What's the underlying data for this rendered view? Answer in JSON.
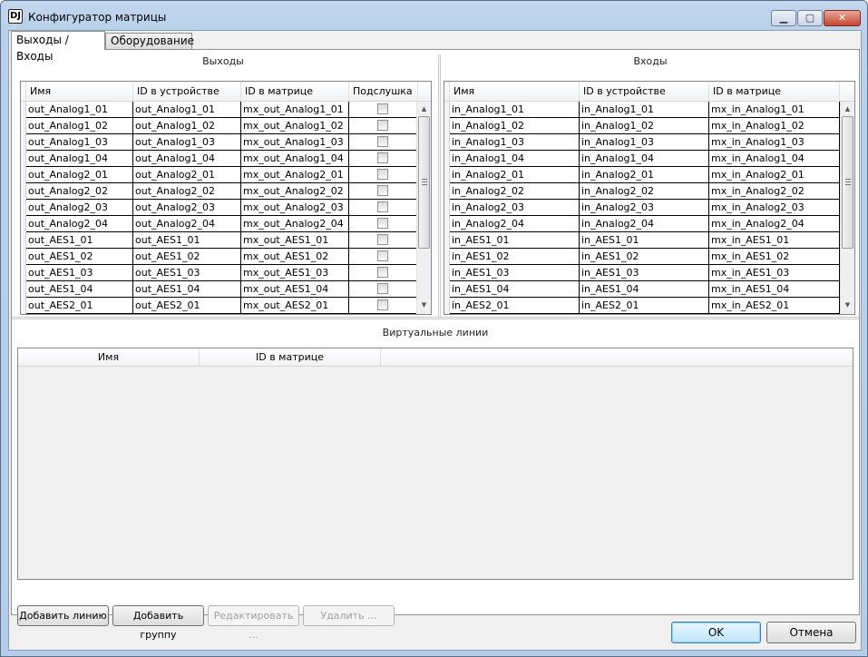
{
  "window": {
    "icon_text": "DJ",
    "title": "Конфигуратор матрицы",
    "min_glyph": "▁",
    "max_glyph": "▢",
    "close_glyph": "✕"
  },
  "tabs": [
    {
      "label": "Выходы / Входы",
      "active": true
    },
    {
      "label": "Оборудование",
      "active": false
    }
  ],
  "outputs": {
    "title": "Выходы",
    "columns": [
      "Имя",
      "ID в устройстве",
      "ID в матрице",
      "Подслушка"
    ],
    "rows": [
      [
        "out_Analog1_01",
        "out_Analog1_01",
        "mx_out_Analog1_01"
      ],
      [
        "out_Analog1_02",
        "out_Analog1_02",
        "mx_out_Analog1_02"
      ],
      [
        "out_Analog1_03",
        "out_Analog1_03",
        "mx_out_Analog1_03"
      ],
      [
        "out_Analog1_04",
        "out_Analog1_04",
        "mx_out_Analog1_04"
      ],
      [
        "out_Analog2_01",
        "out_Analog2_01",
        "mx_out_Analog2_01"
      ],
      [
        "out_Analog2_02",
        "out_Analog2_02",
        "mx_out_Analog2_02"
      ],
      [
        "out_Analog2_03",
        "out_Analog2_03",
        "mx_out_Analog2_03"
      ],
      [
        "out_Analog2_04",
        "out_Analog2_04",
        "mx_out_Analog2_04"
      ],
      [
        "out_AES1_01",
        "out_AES1_01",
        "mx_out_AES1_01"
      ],
      [
        "out_AES1_02",
        "out_AES1_02",
        "mx_out_AES1_02"
      ],
      [
        "out_AES1_03",
        "out_AES1_03",
        "mx_out_AES1_03"
      ],
      [
        "out_AES1_04",
        "out_AES1_04",
        "mx_out_AES1_04"
      ],
      [
        "out_AES2_01",
        "out_AES2_01",
        "mx_out_AES2_01"
      ]
    ]
  },
  "inputs": {
    "title": "Входы",
    "columns": [
      "Имя",
      "ID в устройстве",
      "ID в матрице"
    ],
    "rows": [
      [
        "in_Analog1_01",
        "in_Analog1_01",
        "mx_in_Analog1_01"
      ],
      [
        "in_Analog1_02",
        "in_Analog1_02",
        "mx_in_Analog1_02"
      ],
      [
        "in_Analog1_03",
        "in_Analog1_03",
        "mx_in_Analog1_03"
      ],
      [
        "in_Analog1_04",
        "in_Analog1_04",
        "mx_in_Analog1_04"
      ],
      [
        "in_Analog2_01",
        "in_Analog2_01",
        "mx_in_Analog2_01"
      ],
      [
        "in_Analog2_02",
        "in_Analog2_02",
        "mx_in_Analog2_02"
      ],
      [
        "in_Analog2_03",
        "in_Analog2_03",
        "mx_in_Analog2_03"
      ],
      [
        "in_Analog2_04",
        "in_Analog2_04",
        "mx_in_Analog2_04"
      ],
      [
        "in_AES1_01",
        "in_AES1_01",
        "mx_in_AES1_01"
      ],
      [
        "in_AES1_02",
        "in_AES1_02",
        "mx_in_AES1_02"
      ],
      [
        "in_AES1_03",
        "in_AES1_03",
        "mx_in_AES1_03"
      ],
      [
        "in_AES1_04",
        "in_AES1_04",
        "mx_in_AES1_04"
      ],
      [
        "in_AES2_01",
        "in_AES2_01",
        "mx_in_AES2_01"
      ]
    ]
  },
  "virtual_lines": {
    "title": "Виртуальные линии",
    "columns": [
      "Имя",
      "ID в матрице"
    ]
  },
  "buttons": {
    "add_line": "Добавить линию",
    "add_group": "Добавить группу",
    "edit": "Редактировать ...",
    "delete": "Удалить ...",
    "ok": "OK",
    "cancel": "Отмена"
  },
  "scroll_glyphs": {
    "up": "▲",
    "down": "▼"
  }
}
